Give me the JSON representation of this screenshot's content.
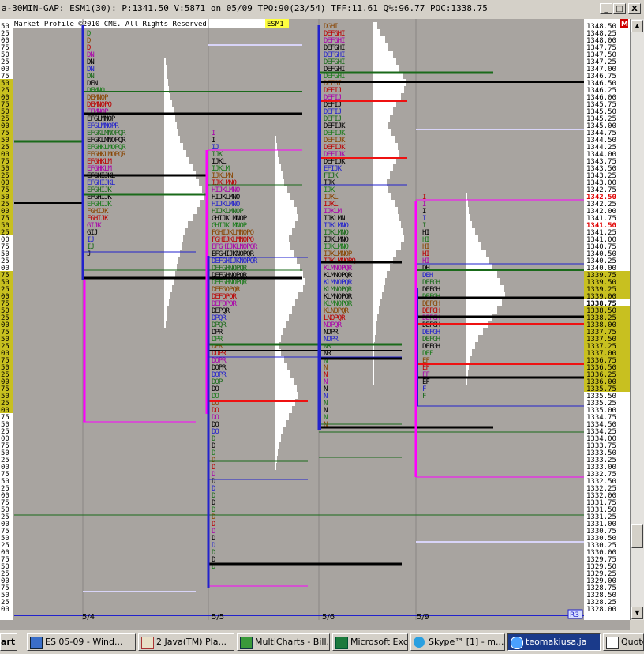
{
  "window": {
    "title": "a-30MIN-GAP: ESM1(30): P:1341.50 V:5871 on 05/09 TPO:90(23/54)  TFF:11.61 Q%:96.77 POC:1338.75",
    "buttons": [
      "_",
      "□",
      "X"
    ]
  },
  "chart": {
    "watermark": "Market Profile ©2010 CME. All Rights Reserved",
    "symbol_badge": "ESM1",
    "corner_badge": "R3",
    "top_right_badge": "M",
    "price_labels": [
      "1348.50",
      "1348.25",
      "1348.00",
      "1347.75",
      "1347.50",
      "1347.25",
      "1347.00",
      "1346.75",
      "1346.50",
      "1346.25",
      "1346.00",
      "1345.75",
      "1345.50",
      "1345.25",
      "1345.00",
      "1344.75",
      "1344.50",
      "1344.25",
      "1344.00",
      "1343.75",
      "1343.50",
      "1343.25",
      "1343.00",
      "1342.75",
      "1342.50",
      "1342.25",
      "1342.00",
      "1341.75",
      "1341.50",
      "1341.25",
      "1341.00",
      "1340.75",
      "1340.50",
      "1340.25",
      "1340.00",
      "1339.75",
      "1339.50",
      "1339.25",
      "1339.00",
      "1338.75",
      "1338.50",
      "1338.25",
      "1338.00",
      "1337.75",
      "1337.50",
      "1337.25",
      "1337.00",
      "1336.75",
      "1336.50",
      "1336.25",
      "1336.00",
      "1335.75",
      "1335.50",
      "1335.25",
      "1335.00",
      "1334.75",
      "1334.50",
      "1334.25",
      "1334.00",
      "1333.75",
      "1333.50",
      "1333.25",
      "1333.00",
      "1332.75",
      "1332.50",
      "1332.25",
      "1332.00",
      "1331.75",
      "1331.50",
      "1331.25",
      "1331.00",
      "1330.75",
      "1330.50",
      "1330.25",
      "1330.00",
      "1329.75",
      "1329.50",
      "1329.25",
      "1329.00",
      "1328.75",
      "1328.50",
      "1328.25",
      "1328.00"
    ],
    "highlight_prices": [
      "1342.50",
      "1341.50",
      "1338.75"
    ],
    "left_labels": [
      "50",
      "25",
      "00",
      "75",
      "50",
      "25",
      "00",
      "75",
      "50",
      "25",
      "00",
      "75",
      "50",
      "25",
      "00",
      "75",
      "50",
      "25",
      "00",
      "75",
      "50",
      "25",
      "00",
      "75",
      "50",
      "25",
      "00",
      "75",
      "50",
      "25",
      "00",
      "75",
      "50",
      "25",
      "00",
      "75",
      "50",
      "25",
      "00",
      "75",
      "50",
      "25",
      "00",
      "75",
      "50",
      "25",
      "00",
      "75",
      "50",
      "25",
      "00",
      "75",
      "50",
      "25",
      "00",
      "75",
      "50",
      "25",
      "00",
      "75",
      "50",
      "25",
      "00",
      "75",
      "50",
      "25",
      "00",
      "75",
      "50",
      "25",
      "00",
      "75",
      "50",
      "25",
      "00",
      "75",
      "50",
      "25",
      "00",
      "75",
      "50",
      "25",
      "00"
    ],
    "dates": [
      "5/4",
      "5/5",
      "5/6",
      "5/9"
    ],
    "colors": {
      "background": "#a8a4a0",
      "price_axis": "#ffffff",
      "value_area": "#c8c020",
      "poc_line": "#000000",
      "green_line": "#1a6a1a",
      "red_line": "#ee1111",
      "magenta_line": "#ff00ff",
      "blue_line": "#2222cc",
      "lavender_line": "#d8d4f8"
    }
  },
  "taskbar": {
    "start": "art",
    "items": [
      {
        "label": "ES 05-09 - Wind...",
        "icon": "window-icon"
      },
      {
        "label": "2 Java(TM) Pla...",
        "icon": "java-icon"
      },
      {
        "label": "MultiCharts - Bill...",
        "icon": "chart-icon"
      },
      {
        "label": "Microsoft Excel",
        "icon": "excel-icon"
      },
      {
        "label": "Skype™ [1] - m...",
        "icon": "skype-icon"
      },
      {
        "label": "teomakiusa.ja",
        "icon": "chat-icon"
      },
      {
        "label": "Quote",
        "icon": "quote-icon"
      }
    ]
  }
}
